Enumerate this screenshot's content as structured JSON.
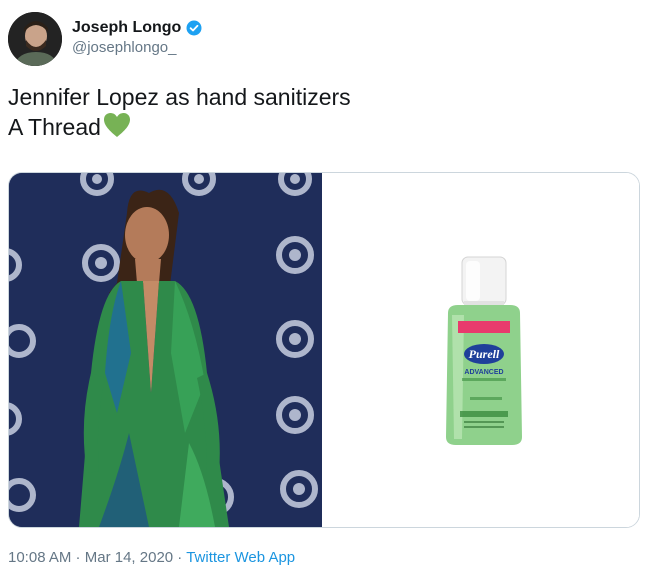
{
  "user": {
    "display_name": "Joseph Longo",
    "handle": "@josephlongo_"
  },
  "tweet": {
    "text_line1": "Jennifer Lopez as hand sanitizers",
    "text_line2": "A Thread"
  },
  "media": {
    "sanitizer_brand": "Purell",
    "sanitizer_sub": "ADVANCED"
  },
  "meta": {
    "time": "10:08 AM",
    "separator": " · ",
    "date": "Mar 14, 2020",
    "source": "Twitter Web App"
  },
  "colors": {
    "verified": "#1da1f2",
    "link": "#1b95e0",
    "heart": "#77b255",
    "backdrop": "#1f2d5a"
  }
}
